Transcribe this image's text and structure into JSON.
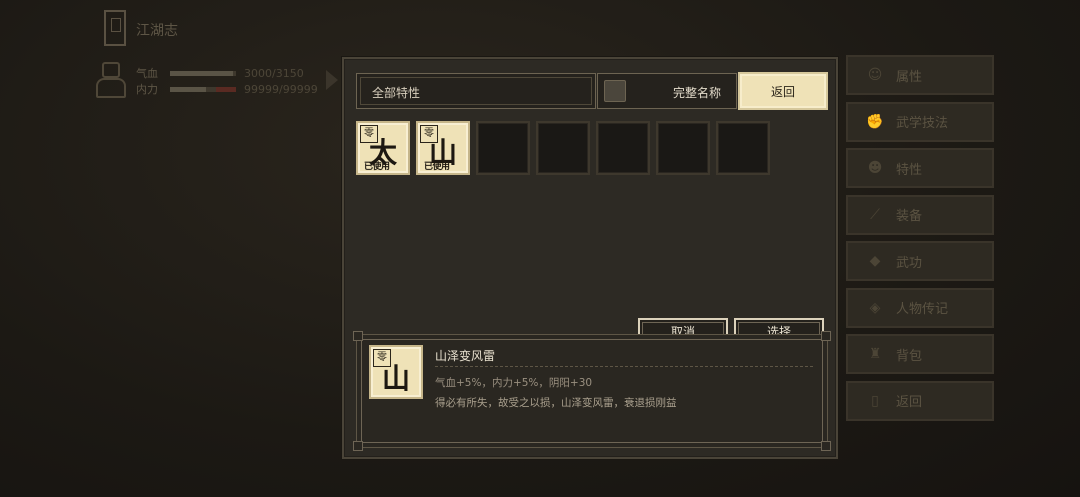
{
  "background": {
    "title": "江湖志",
    "stats": [
      {
        "label": "气血",
        "value": "3000/3150",
        "fraction": 0.95,
        "color": "#5a2a22"
      },
      {
        "label": "内力",
        "value": "99999/99999",
        "fraction": 1.0,
        "color": "#3c3a36"
      }
    ]
  },
  "side_menu": {
    "items": [
      {
        "label": "属性",
        "icon": "person-icon"
      },
      {
        "label": "武学技法",
        "icon": "fist-icon"
      },
      {
        "label": "特性",
        "icon": "trait-icon"
      },
      {
        "label": "装备",
        "icon": "sword-icon"
      },
      {
        "label": "武功",
        "icon": "manual-icon"
      },
      {
        "label": "人物传记",
        "icon": "biography-icon"
      },
      {
        "label": "背包",
        "icon": "bag-icon"
      },
      {
        "label": "返回",
        "icon": "exit-icon"
      }
    ]
  },
  "dialog": {
    "filter_label": "全部特性",
    "name_label": "完整名称",
    "back_label": "返回",
    "slots": [
      {
        "glyph": "太",
        "badge": "零",
        "used": "已使用"
      },
      {
        "glyph": "山",
        "badge": "零",
        "used": "已使用"
      },
      {},
      {},
      {},
      {},
      {}
    ],
    "cancel_label": "取消",
    "select_label": "选择",
    "detail": {
      "badge": "零",
      "glyph": "山",
      "name": "山泽变风雷",
      "stats": "气血+5%，内力+5%，阴阳+30",
      "desc": "得必有所失，故受之以损，山泽变风雷，衰退损刚益"
    }
  },
  "colors": {
    "card": "#efe2b7",
    "panel": "#2d2a24",
    "slot_empty": "#1a1815"
  }
}
